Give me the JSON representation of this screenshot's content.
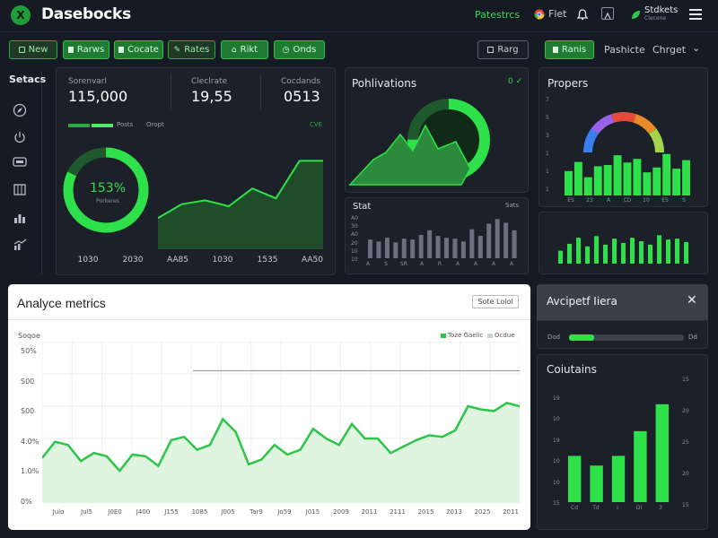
{
  "header": {
    "logo_glyph": "X",
    "title": "Dasebocks",
    "link": "Patestrcs",
    "items": [
      {
        "icon": "chrome-icon",
        "label": "Flet"
      },
      {
        "icon": "bell-icon",
        "label": ""
      },
      {
        "icon": "grid-icon",
        "label": ""
      }
    ],
    "account": {
      "label": "Stdkets",
      "sub": "Clecene"
    }
  },
  "toolbar": {
    "buttons": [
      "New",
      "Rarws",
      "Cocate",
      "Rates",
      "Rikt",
      "Onds"
    ],
    "right_buttons": [
      "Rarg",
      "Ranis"
    ],
    "text_items": [
      "Pashicte",
      "Chrget"
    ]
  },
  "sidebar": {
    "title": "Setacs",
    "icons": [
      "compass-icon",
      "power-icon",
      "monitor-icon",
      "calendar-icon",
      "bar-chart-icon",
      "trend-icon"
    ]
  },
  "stats_panel": {
    "metrics": [
      {
        "label": "Sorenvarl",
        "value": "115,000"
      },
      {
        "label": "Cleclrate",
        "value": "19,55"
      },
      {
        "label": "Cocdands",
        "value": "0513"
      }
    ],
    "legend": [
      "Posts",
      "Oropt"
    ],
    "legend_right": "CVE",
    "donut": {
      "value_text": "153%",
      "sub": "Porkeres",
      "fraction": 0.82
    },
    "x_labels": [
      "1030",
      "2030",
      "AA85",
      "1030",
      "1535",
      "AA50"
    ],
    "area": [
      28,
      42,
      46,
      40,
      58,
      48,
      86,
      86
    ]
  },
  "pub_panel": {
    "title": "Pohlivations",
    "badge": "0 ✓",
    "donut_fraction": 0.75
  },
  "stat_bars": {
    "title": "Stat",
    "right_label": "Sats",
    "y_labels": [
      "A0",
      "30",
      "A0",
      "20",
      "10",
      "10"
    ],
    "x_labels": [
      "A",
      "S",
      "SR",
      "A",
      "R",
      "A",
      "A",
      "A",
      "A"
    ],
    "values": [
      40,
      36,
      44,
      34,
      42,
      40,
      50,
      60,
      48,
      44,
      42,
      36,
      62,
      48,
      74,
      84,
      76,
      60
    ]
  },
  "progress_panel": {
    "title": "Propers",
    "gauge_colors": [
      "#3a7ff0",
      "#9a62e8",
      "#e84a3a",
      "#e88a2a",
      "#a4d44a"
    ],
    "y_labels": [
      "7",
      "5",
      "3",
      "1",
      "1",
      "1"
    ],
    "x_labels": [
      "ES",
      "23",
      "A",
      "CD",
      "10",
      "ES",
      "S"
    ],
    "values_top": [
      40,
      55,
      30,
      48,
      50,
      66,
      54,
      60,
      38,
      46,
      68,
      44,
      58
    ],
    "values_bottom": [
      30,
      46,
      60,
      40,
      64,
      44,
      58,
      48,
      60,
      52,
      44,
      66,
      56,
      58,
      50
    ]
  },
  "analytics": {
    "title": "Analyce metrics",
    "button": "Sote Lolol",
    "y_title": "Soqoe",
    "y_labels": [
      "50%",
      "S00",
      "S00",
      "4.0%",
      "1.0%",
      "0%"
    ],
    "legend": [
      "Toze Gaelic",
      "Ocdue"
    ],
    "x_labels": [
      "Julo",
      "Jul5",
      "J0E0",
      "J400",
      "J155",
      "1085",
      "J005",
      "Tar9",
      "Jo59",
      "J015",
      "2009",
      "2011",
      "2111",
      "2015",
      "2013",
      "2025",
      "2011"
    ],
    "values": [
      28,
      38,
      36,
      26,
      31,
      29,
      20,
      30,
      29,
      23,
      39,
      41,
      33,
      36,
      52,
      44,
      24,
      27,
      36,
      30,
      33,
      46,
      40,
      36,
      49,
      40,
      40,
      31,
      35,
      39,
      42,
      41,
      45,
      60,
      58,
      57,
      62,
      60
    ],
    "threshold": 82
  },
  "alert_panel": {
    "title": "Avcipetf Iiera",
    "progress_left": "Dod",
    "progress_right": "Dd",
    "progress": 0.22
  },
  "cols_panel": {
    "title": "Coiutains",
    "y_labels": [
      "19",
      "10",
      "19",
      "10",
      "10",
      "15"
    ],
    "right_labels": [
      "15",
      "20",
      "25",
      "20",
      "15"
    ],
    "x_labels": [
      "Cd",
      "Td",
      "I",
      "Di",
      "3"
    ],
    "values": [
      43,
      34,
      43,
      66,
      91
    ]
  },
  "colors": {
    "accent": "#2ee04a",
    "accent_dark": "#1f7a33",
    "bg": "#161a24",
    "panel": "#1b2029"
  }
}
